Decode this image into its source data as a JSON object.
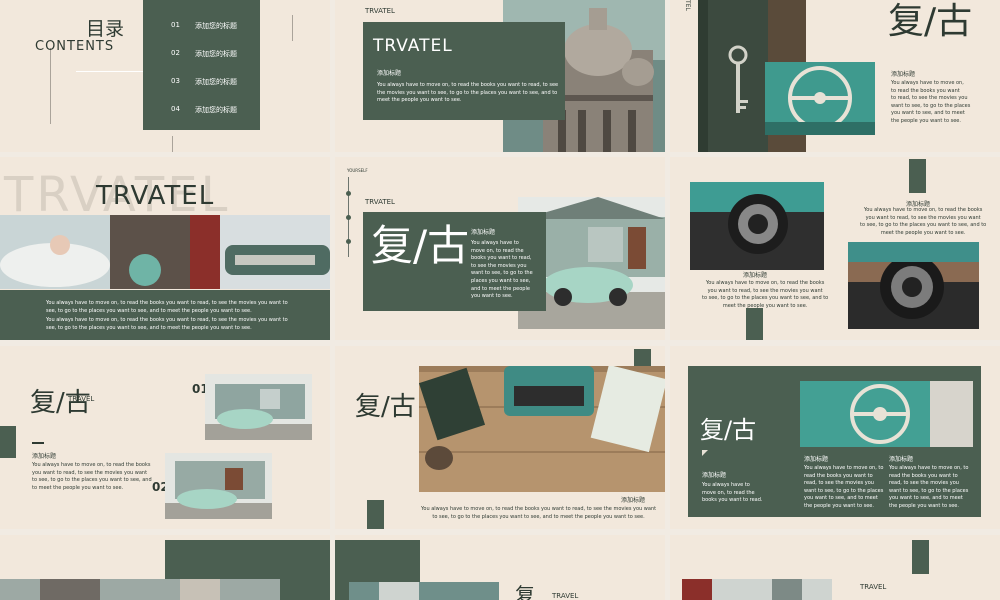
{
  "colors": {
    "green": "#4b5f51",
    "beige": "#f2e8dc",
    "dark": "#2e3a32"
  },
  "s1": {
    "title_cn": "目录",
    "title_en": "CONTENTS",
    "items": [
      {
        "num": "01",
        "label": "添加您的标题"
      },
      {
        "num": "02",
        "label": "添加您的标题"
      },
      {
        "num": "03",
        "label": "添加您的标题"
      },
      {
        "num": "04",
        "label": "添加您的标题"
      }
    ]
  },
  "s2": {
    "small": "TRVATEL",
    "title": "TRVATEL",
    "subtitle": "添加标题",
    "body": "You always have  to move on, to read the books you want to read, to see\nthe movies you want to see, to go to the places you want to see, and to\nmeet the people you want to see."
  },
  "s3": {
    "side": "TEL",
    "big": "复/古",
    "subtitle": "添加标题",
    "body": "You always have  to move on,\nto read the books you want\nto read, to see the movies you\nwant to see, to go to the places\nyou want to see, and to meet\nthe people you want to see."
  },
  "s4": {
    "watermark": "TRVATEL",
    "title": "TRVATEL",
    "body1": "You always have  to move on, to read the books you want to read, to see the movies you want to\nsee, to go to the places you want to see, and to meet the people you want to see.",
    "body2": "You always have  to move on, to read the books you want to read, to see the movies you want to\nsee, to go to the places you want to see, and to meet the people you want to see."
  },
  "s5": {
    "tag": "YOURSELF",
    "small": "TRVATEL",
    "big": "复/古",
    "subtitle": "添加标题",
    "body": "You always have  to\nmove on, to read the\nbooks you want to read,\nto see the movies you\nwant to see, to go to the\nplaces you want to see,\nand to meet the people\nyou want to see."
  },
  "s6": {
    "subtitle": "添加标题",
    "body": "You always have  to move on, to read the books\nyou want to read, to see the movies you want\nto see, to go to the places you want to see, and to\nmeet the people you want to see."
  },
  "s7": {
    "subtitle": "添加标题",
    "body": "You always have  to move on, to read the books\nyou want to read, to see the movies you want\nto see, to go to the places you want to see, and to\nmeet the people you want to see."
  },
  "s8": {
    "big": "复/古",
    "small": "TRAVEL",
    "subtitle": "添加标题",
    "body": "You always have  to move on, to read the books\nyou want to read, to see the movies you want\nto see, to go to the places you want to see, and\nto meet the people you want to see.",
    "num1": "01",
    "num2": "02"
  },
  "s9": {
    "big": "复/古",
    "subtitle": "添加标题",
    "body": "You always have  to move on, to read the books you want to read, to see the movies you want\nto see, to go to the places you want to see, and to meet the people you want to see."
  },
  "s10": {
    "big": "复/古",
    "subtitle": "添加标题",
    "body": "You always have  to\nmove on, to read the\nbooks you want to read.",
    "col1_title": "添加标题",
    "col1_body": "You always have  to move on, to\nread the books you want to\nread, to see the movies you\nwant to see, to go to the places\nyou want to see, and to meet\nthe people you want to see.",
    "col2_title": "添加标题",
    "col2_body": "You always have  to move on, to\nread the books you want to\nread, to see the movies you\nwant to see, to go to the places\nyou want to see, and to meet\nthe people you want to see."
  },
  "s12": {
    "big": "复",
    "small": "TRAVEL"
  },
  "s13": {
    "small": "TRAVEL"
  },
  "icons": [
    "slide-thumbnail",
    "photo-placeholder"
  ]
}
